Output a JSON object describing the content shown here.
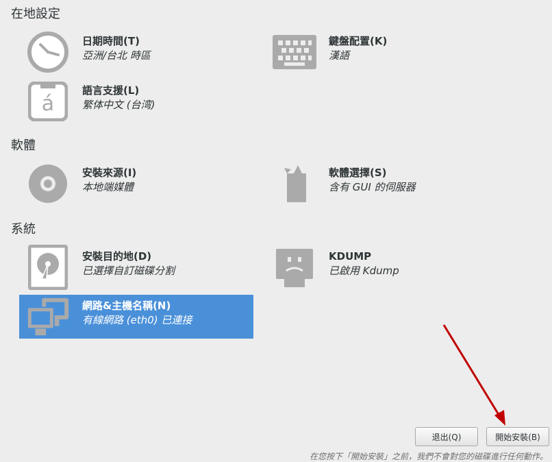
{
  "sections": {
    "localization": "在地設定",
    "software": "軟體",
    "system": "系統"
  },
  "spokes": {
    "datetime": {
      "title": "日期時間(T)",
      "status": "亞洲/台北 時區",
      "icon": "clock-icon"
    },
    "keyboard": {
      "title": "鍵盤配置(K)",
      "status": "漢語",
      "icon": "keyboard-icon"
    },
    "language": {
      "title": "語言支援(L)",
      "status": "繁体中文 (台湾)",
      "icon": "language-icon",
      "glyph": "á"
    },
    "source": {
      "title": "安裝來源(I)",
      "status": "本地端媒體",
      "icon": "disc-icon"
    },
    "software": {
      "title": "軟體選擇(S)",
      "status": "含有 GUI 的伺服器",
      "icon": "package-icon"
    },
    "destination": {
      "title": "安裝目的地(D)",
      "status": "已選擇自訂磁碟分割",
      "icon": "harddisk-icon"
    },
    "kdump": {
      "title": "KDUMP",
      "status": "已啟用 Kdump",
      "icon": "kdump-icon"
    },
    "network": {
      "title": "網路&主機名稱(N)",
      "status": "有線網路 (eth0) 已連接",
      "icon": "network-icon",
      "selected": true
    }
  },
  "buttons": {
    "quit": "退出(Q)",
    "begin": "開始安裝(B)"
  },
  "footer_note": "在您按下「開始安裝」之前，我們不會對您的磁碟進行任何動作。",
  "colors": {
    "background": "#ededed",
    "icon_gray": "#aaaaaa",
    "selected_bg": "#4a90d9",
    "arrow": "#c00000"
  }
}
